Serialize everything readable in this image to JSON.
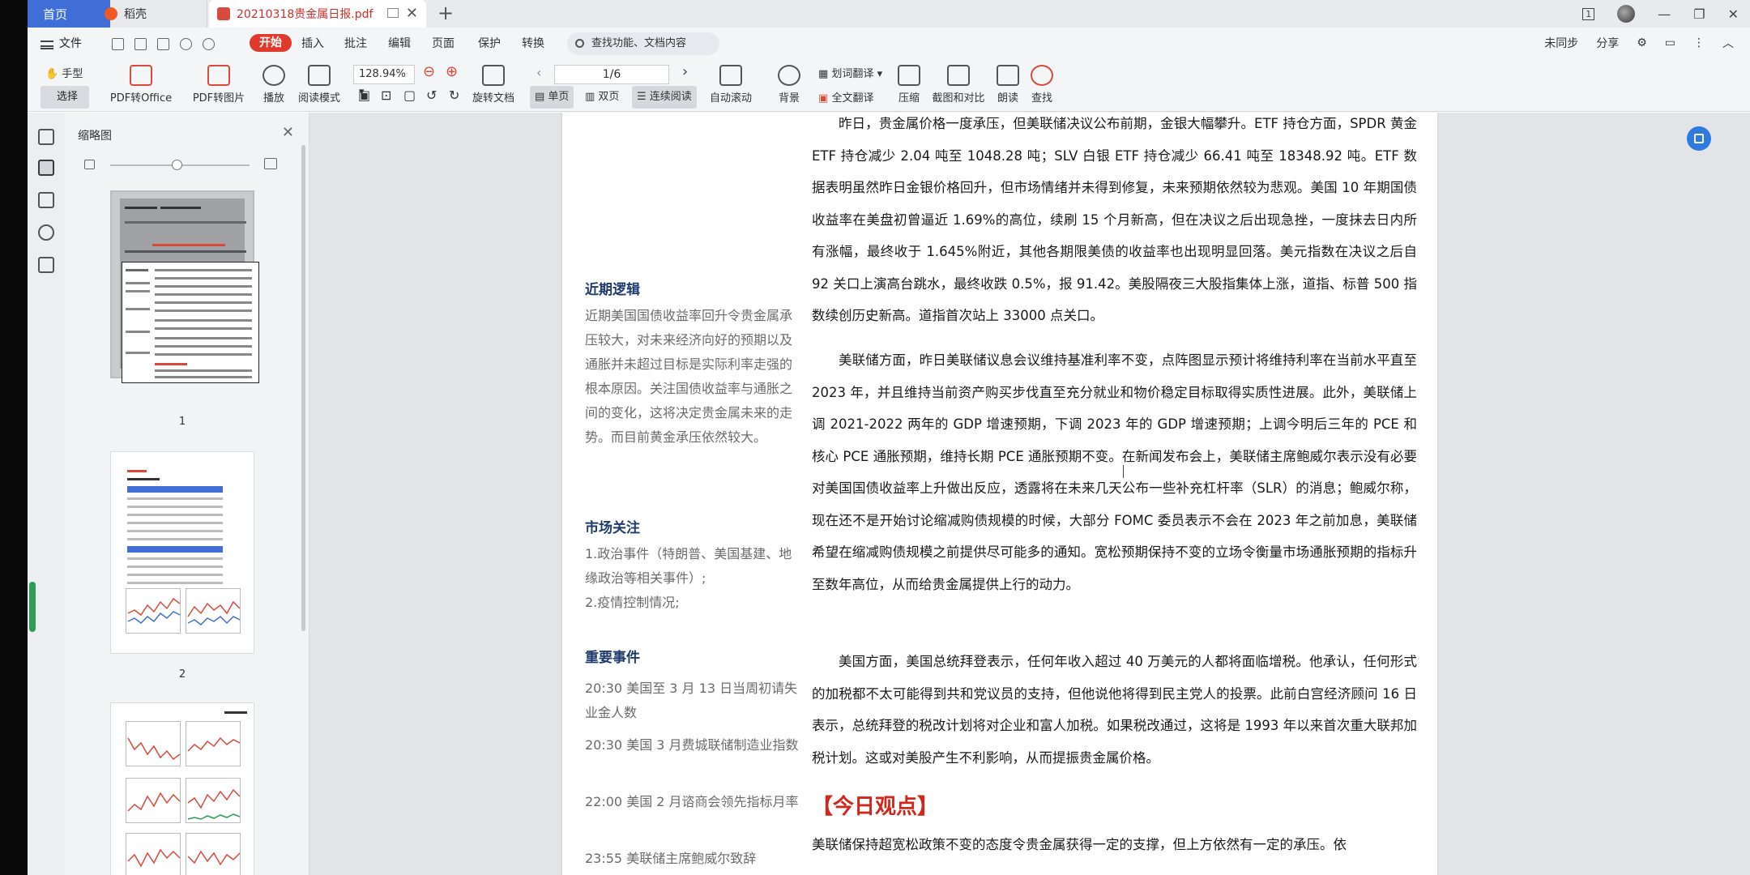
{
  "tabs": {
    "home": "首页",
    "daoke": "稻壳",
    "pdf": "20210318贵金属日报.pdf"
  },
  "window": {
    "counter": "1"
  },
  "menu": {
    "file": "文件",
    "start": "开始",
    "items": [
      "插入",
      "批注",
      "编辑",
      "页面",
      "保护",
      "转换"
    ],
    "search_placeholder": "查找功能、文档内容",
    "right": [
      "未同步",
      "分享"
    ]
  },
  "ribbon": {
    "hand": "手型",
    "select": "选择",
    "pdf_to_office": "PDF转Office",
    "pdf_to_image": "PDF转图片",
    "play": "播放",
    "read_mode": "阅读模式",
    "zoom": "128.94%",
    "rotate": "旋转文档",
    "page_indicator": "1/6",
    "single": "单页",
    "double": "双页",
    "continuous": "连续阅读",
    "auto_scroll": "自动滚动",
    "background": "背景",
    "word_translate": "划词翻译",
    "full_translate": "全文翻译",
    "compress": "压缩",
    "screenshot_compare": "截图和对比",
    "read_aloud": "朗读",
    "find": "查找"
  },
  "thumbnails": {
    "title": "缩略图",
    "pages": [
      "1",
      "2"
    ]
  },
  "document": {
    "side": {
      "logic_title": "近期逻辑",
      "logic_body": "近期美国国债收益率回升令贵金属承压较大，对未来经济向好的预期以及通胀并未超过目标是实际利率走强的根本原因。关注国债收益率与通胀之间的变化，这将决定贵金属未来的走势。而目前黄金承压依然较大。",
      "market_title": "市场关注",
      "market_body_1": "1.政治事件（特朗普、美国基建、地缘政治等相关事件）;",
      "market_body_2": "2.疫情控制情况;",
      "events_title": "重要事件",
      "events": [
        "20:30  美国至 3 月 13 日当周初请失业金人数",
        "20:30  美国 3 月费城联储制造业指数",
        "22:00  美国 2 月谘商会领先指标月率",
        "23:55  美联储主席鲍威尔致辞"
      ]
    },
    "paragraphs": [
      "昨日，贵金属价格一度承压，但美联储决议公布前期，金银大幅攀升。ETF 持仓方面，SPDR 黄金 ETF 持仓减少 2.04 吨至 1048.28 吨；SLV 白银 ETF 持仓减少 66.41 吨至 18348.92 吨。ETF 数据表明虽然昨日金银价格回升，但市场情绪并未得到修复，未来预期依然较为悲观。美国 10 年期国债收益率在美盘初曾逼近 1.69%的高位，续刷 15 个月新高，但在决议之后出现急挫，一度抹去日内所有涨幅，最终收于 1.645%附近，其他各期限美债的收益率也出现明显回落。美元指数在决议之后自 92 关口上演高台跳水，最终收跌 0.5%，报 91.42。美股隔夜三大股指集体上涨，道指、标普 500 指数续创历史新高。道指首次站上 33000 点关口。",
      "美联储方面，昨日美联储议息会议维持基准利率不变，点阵图显示预计将维持利率在当前水平直至 2023 年，并且维持当前资产购买步伐直至充分就业和物价稳定目标取得实质性进展。此外，美联储上调 2021-2022 两年的 GDP 增速预期，下调 2023 年的 GDP 增速预期；上调今明后三年的 PCE 和核心 PCE 通胀预期，维持长期 PCE 通胀预期不变。在新闻发布会上，美联储主席鲍威尔表示没有必要对美国国债收益率上升做出反应，透露将在未来几天公布一些补充杠杆率（SLR）的消息；鲍威尔称，现在还不是开始讨论缩减购债规模的时候，大部分 FOMC 委员表示不会在 2023 年之前加息，美联储希望在缩减购债规模之前提供尽可能多的通知。宽松预期保持不变的立场令衡量市场通胀预期的指标升至数年高位，从而给贵金属提供上行的动力。",
      "美国方面，美国总统拜登表示，任何年收入超过 40 万美元的人都将面临增税。他承认，任何形式的加税都不太可能得到共和党议员的支持，但他说他将得到民主党人的投票。此前白宫经济顾问 16 日表示，总统拜登的税改计划将对企业和富人加税。如果税改通过，这将是 1993 年以来首次重大联邦加税计划。这或对美股产生不利影响，从而提振贵金属价格。"
    ],
    "today_view_title": "【今日观点】",
    "today_view_body": "美联储保持超宽松政策不变的态度令贵金属获得一定的支撑，但上方依然有一定的承压。依"
  },
  "colors": {
    "accent_blue": "#3f6fd6",
    "start_red": "#e03a2c",
    "heading_red": "#d0271d",
    "side_heading": "#1f3b6e"
  }
}
